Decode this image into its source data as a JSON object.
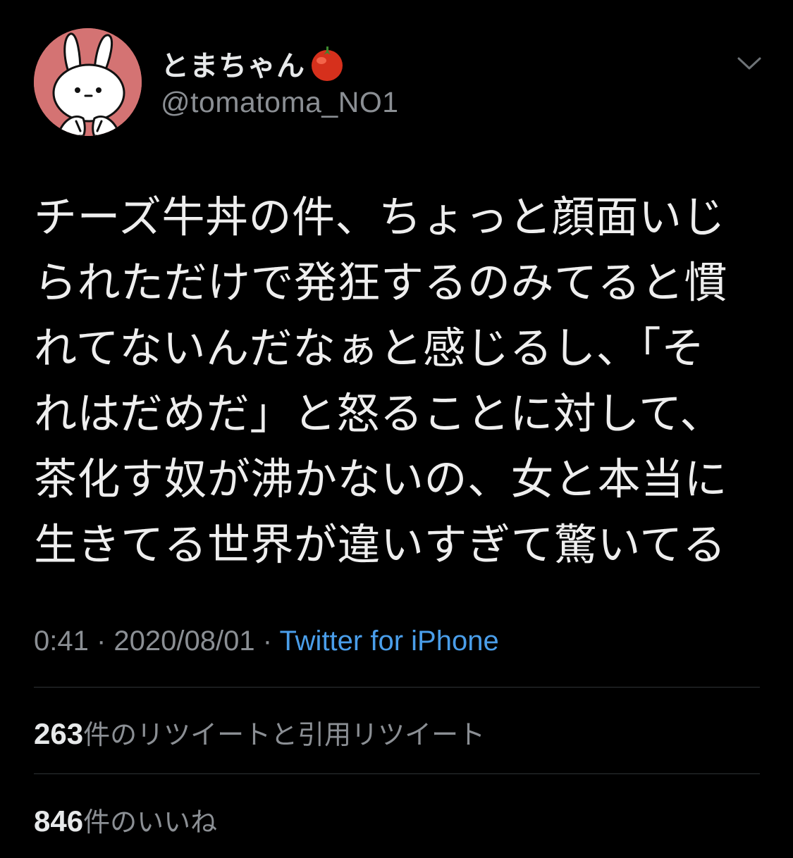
{
  "user": {
    "display_name": "とまちゃん",
    "emoji_icon": "tomato-icon",
    "handle": "@tomatoma_NO1"
  },
  "tweet": {
    "lines": [
      "チーズ牛丼の件、ちょっと顔面いじ",
      "られただけで発狂するのみてると慣",
      "れてないんだなぁと感じるし、「そ",
      "れはだめだ」と怒ることに対して、",
      "茶化す奴が沸かないの、女と本当に",
      "生きてる世界が違いすぎて驚いてる"
    ]
  },
  "meta": {
    "time": "0:41",
    "separator": " · ",
    "date": "2020/08/01",
    "source": "Twitter for iPhone"
  },
  "stats": {
    "retweets_count": "263",
    "retweets_label": "件のリツイートと引用リツイート",
    "likes_count": "846",
    "likes_label": "件のいいね"
  },
  "colors": {
    "background": "#000000",
    "text": "#e7e9ea",
    "secondary": "#8b8f94",
    "link": "#4a9eea",
    "divider": "#2f3336",
    "avatar_bg": "#d47373"
  },
  "icons": {
    "more": "chevron-down-icon",
    "avatar": "rabbit-avatar"
  }
}
